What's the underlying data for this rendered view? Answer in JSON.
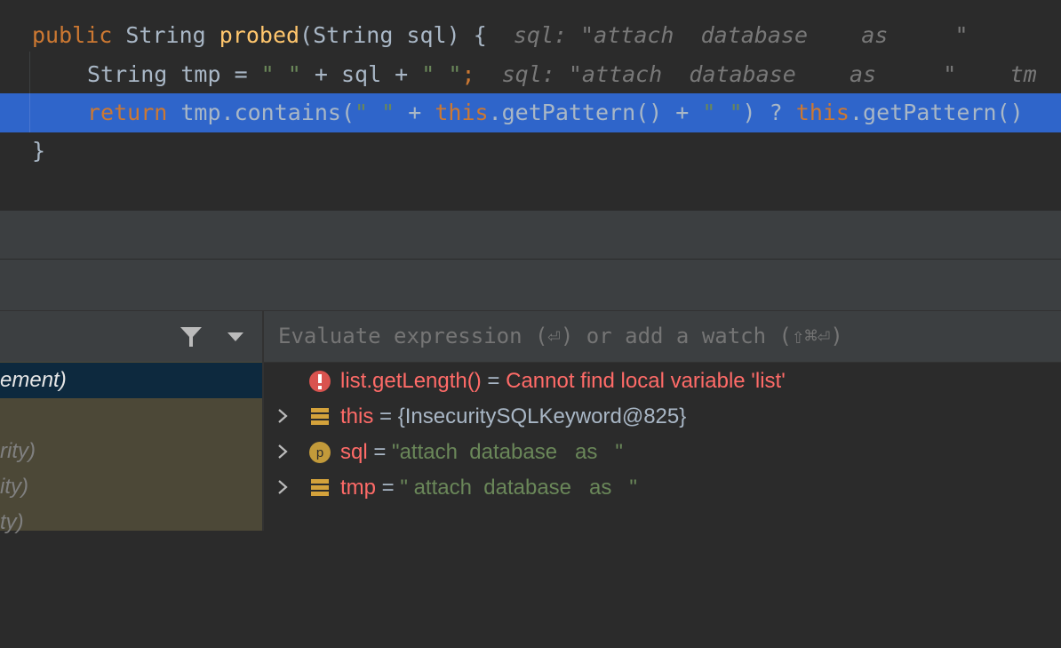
{
  "editor": {
    "line1": {
      "kw": "public",
      "type": " String ",
      "method": "probed",
      "params": "(String sql) {",
      "hint": "  sql: \"attach  database    as     \""
    },
    "line2": {
      "code": "String tmp = ",
      "s1": "\" \"",
      "mid": " + sql + ",
      "s2": "\" \"",
      "semi": ";",
      "hint": "  sql: \"attach  database    as     \"    tm"
    },
    "line3": {
      "kw": "return",
      "a": " tmp.contains(",
      "s1": "\" \"",
      "b": " + ",
      "this1": "this",
      "c": ".getPattern() + ",
      "s2": "\" \"",
      "d": ") ? ",
      "this2": "this",
      "e": ".getPattern()"
    },
    "line4": {
      "code": "}"
    }
  },
  "frames": {
    "rows": [
      "ement)",
      "",
      "rity)",
      "ity)",
      "ty)"
    ]
  },
  "evaluate": {
    "placeholder": "Evaluate expression (⏎) or add a watch (⇧⌘⏎)"
  },
  "variables": [
    {
      "icon": "error-icon",
      "name": "list.getLength()",
      "eq": " = ",
      "value": "Cannot find local variable 'list'",
      "kind": "error",
      "expandable": false
    },
    {
      "icon": "field-icon",
      "name": "this",
      "eq": " = ",
      "value": "{InsecuritySQLKeyword@825}",
      "kind": "object",
      "expandable": true
    },
    {
      "icon": "parameter-icon",
      "name": "sql",
      "eq": " = ",
      "value": "\"attach  database   as   \"",
      "kind": "string",
      "expandable": true
    },
    {
      "icon": "field-icon",
      "name": "tmp",
      "eq": " = ",
      "value": "\" attach  database   as   \"",
      "kind": "string",
      "expandable": true
    }
  ],
  "colors": {
    "keyword": "#cc7832",
    "method": "#ffc66d",
    "string": "#6a8759",
    "selection": "#2f65ca",
    "error": "#ff6b68"
  }
}
